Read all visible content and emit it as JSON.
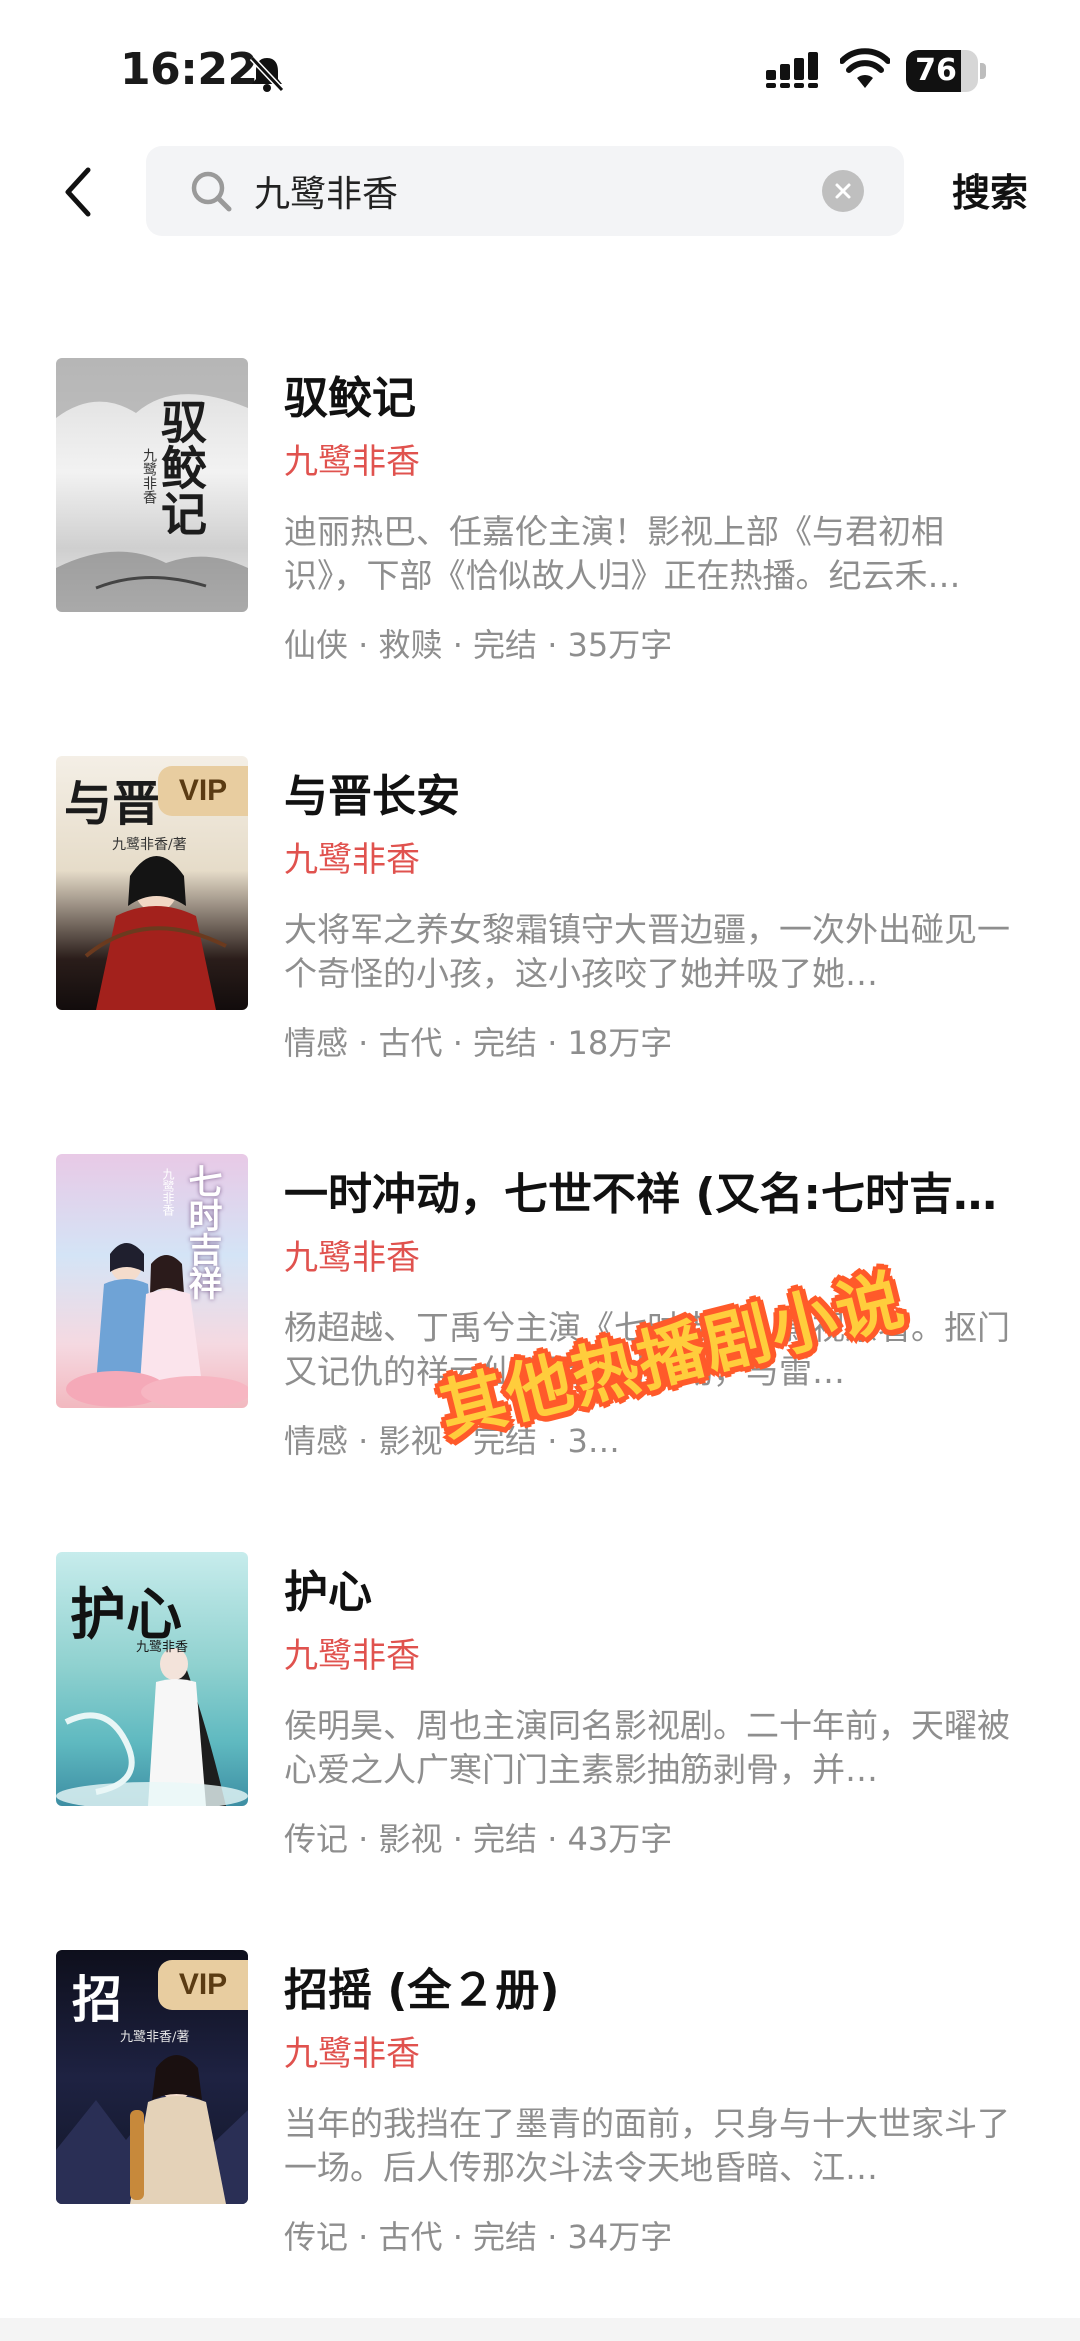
{
  "status_bar": {
    "time": "16:22",
    "battery_level": 76,
    "battery_text": "76"
  },
  "header": {
    "search_value": "九鹭非香",
    "search_button": "搜索"
  },
  "results": [
    {
      "title": "驭鲛记",
      "author": "九鹭非香",
      "description": "迪丽热巴、任嘉伦主演！影视上部《与君初相识》，下部《恰似故人归》正在热播。纪云禾…",
      "meta": "仙侠 · 救赎 · 完结 · 35万字",
      "vip": false,
      "cover_text": "驭鲛记",
      "cover_author": "九鹭非香"
    },
    {
      "title": "与晋长安",
      "author": "九鹭非香",
      "description": "大将军之养女黎霜镇守大晋边疆，一次外出碰见一个奇怪的小孩，这小孩咬了她并吸了她…",
      "meta": "情感 · 古代 · 完结 · 18万字",
      "vip": true,
      "vip_label": "VIP",
      "cover_text": "与晋",
      "cover_author": "九鹭非香/著"
    },
    {
      "title": "一时冲动，七世不祥 (又名:七时吉祥)",
      "author": "九鹭非香",
      "description": "杨超越、丁禹兮主演《七时吉祥》影视原著。抠门又记仇的祥云仙子因一时冲动，与雷…",
      "meta": "情感 · 影视 · 完结 · 3…",
      "vip": false,
      "cover_text": "七时吉祥",
      "cover_author": "九鹭非香"
    },
    {
      "title": "护心",
      "author": "九鹭非香",
      "description": "侯明昊、周也主演同名影视剧。二十年前，天曜被心爱之人广寒门门主素影抽筋剥骨，并…",
      "meta": "传记 · 影视 · 完结 · 43万字",
      "vip": false,
      "cover_text": "护心",
      "cover_author": "九鹭非香"
    },
    {
      "title": "招摇 (全２册)",
      "author": "九鹭非香",
      "description": "当年的我挡在了墨青的面前，只身与十大世家斗了一场。后人传那次斗法令天地昏暗、江…",
      "meta": "传记 · 古代 · 完结 · 34万字",
      "vip": true,
      "vip_label": "VIP",
      "cover_text": "招",
      "cover_author": "九鹭非香/著"
    }
  ],
  "overlay": {
    "caption": "其他热播剧小说"
  },
  "colors": {
    "author": "#e0524e",
    "muted": "#8e8e8e",
    "search_bg": "#f3f4f6",
    "vip_bg": "#e8cda0",
    "caption_fill": "#ffcd3c",
    "caption_stroke": "#ff5a2a"
  }
}
